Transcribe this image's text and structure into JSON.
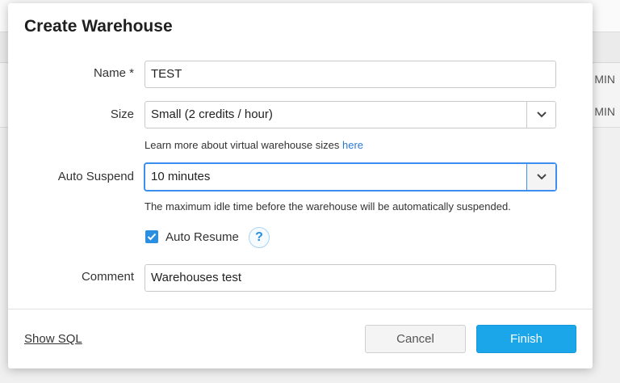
{
  "background": {
    "cells": [
      "MIN",
      "MIN"
    ]
  },
  "dialog": {
    "title": "Create Warehouse",
    "fields": {
      "name": {
        "label": "Name",
        "required_mark": "*",
        "value": "TEST"
      },
      "size": {
        "label": "Size",
        "value": "Small  (2 credits / hour)",
        "help_text": "Learn more about virtual warehouse sizes",
        "help_link": "here"
      },
      "auto_suspend": {
        "label": "Auto Suspend",
        "value": "10 minutes",
        "help_text": "The maximum idle time before the warehouse will be automatically suspended."
      },
      "auto_resume": {
        "label": "Auto Resume",
        "checked": true,
        "help_icon": "?"
      },
      "comment": {
        "label": "Comment",
        "value": "Warehouses test"
      }
    },
    "footer": {
      "show_sql": "Show SQL",
      "cancel": "Cancel",
      "finish": "Finish"
    }
  },
  "colors": {
    "accent": "#1ba6ea",
    "link": "#2a7ad6",
    "focus": "#3d8ef0"
  }
}
